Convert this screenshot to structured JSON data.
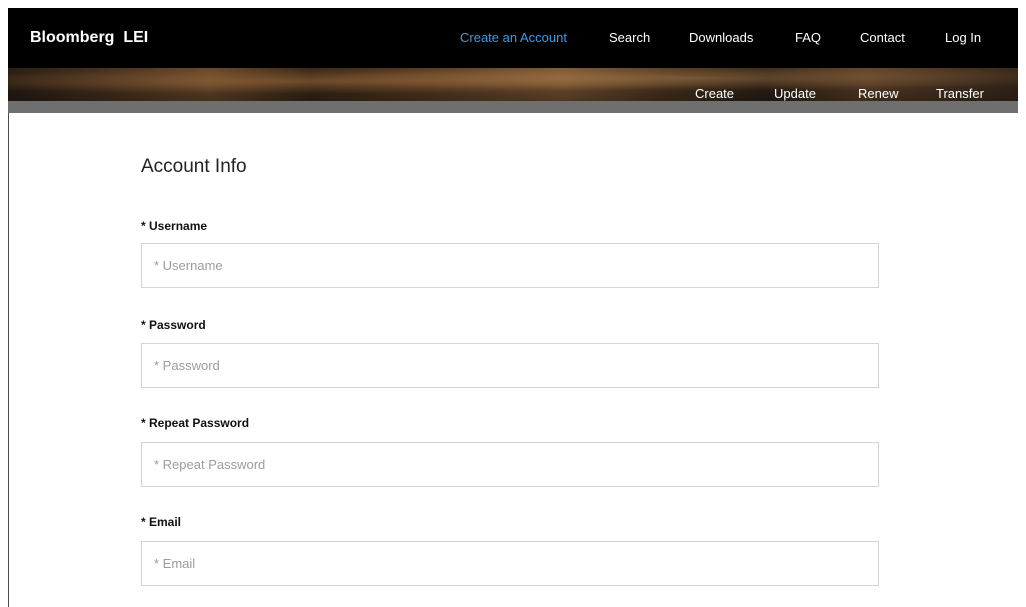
{
  "header": {
    "brand": "Bloomberg  LEI",
    "nav": [
      {
        "label": "Create an Account",
        "active": true
      },
      {
        "label": "Search",
        "active": false
      },
      {
        "label": "Downloads",
        "active": false
      },
      {
        "label": "FAQ",
        "active": false
      },
      {
        "label": "Contact",
        "active": false
      },
      {
        "label": "Log In",
        "active": false
      }
    ],
    "subnav": [
      {
        "label": "Create"
      },
      {
        "label": "Update"
      },
      {
        "label": "Renew"
      },
      {
        "label": "Transfer"
      }
    ],
    "active_color": "#3d9be9"
  },
  "form": {
    "title": "Account Info",
    "fields": [
      {
        "label": "* Username",
        "placeholder": "* Username",
        "value": ""
      },
      {
        "label": "* Password",
        "placeholder": "* Password",
        "value": ""
      },
      {
        "label": "* Repeat Password",
        "placeholder": "* Repeat Password",
        "value": ""
      },
      {
        "label": "* Email",
        "placeholder": "* Email",
        "value": ""
      }
    ]
  }
}
